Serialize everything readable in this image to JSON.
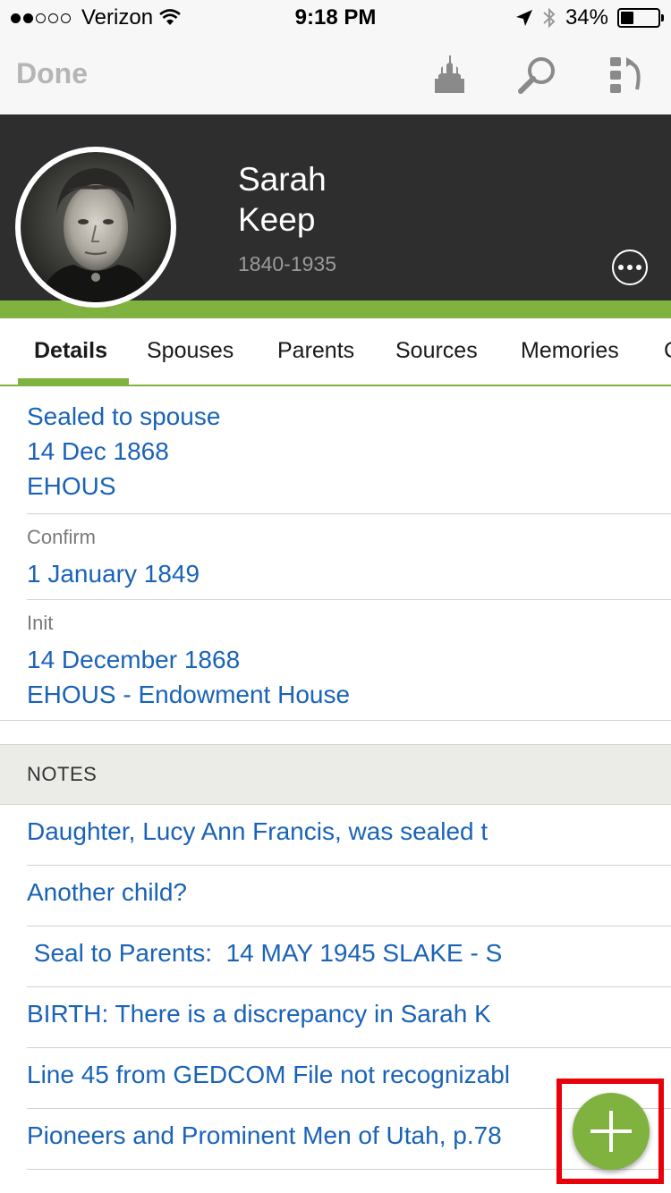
{
  "status_bar": {
    "carrier": "Verizon",
    "time": "9:18 PM",
    "battery_percent": "34%",
    "battery_level": 0.34,
    "signal_bars_filled": 2,
    "signal_bars_total": 5
  },
  "toolbar": {
    "done_label": "Done",
    "icons": [
      "temple-icon",
      "search-icon",
      "tree-switch-icon"
    ]
  },
  "person": {
    "first_name": "Sarah",
    "last_name": "Keep",
    "dates": "1840-1935"
  },
  "tabs": [
    {
      "label": "Details",
      "active": true
    },
    {
      "label": "Spouses"
    },
    {
      "label": "Parents"
    },
    {
      "label": "Sources"
    },
    {
      "label": "Memories"
    },
    {
      "label": "C"
    }
  ],
  "details": {
    "sealed": {
      "title": "Sealed to spouse",
      "date": "14 Dec 1868",
      "temple": "EHOUS"
    },
    "confirm": {
      "label": "Confirm",
      "date": "1 January 1849"
    },
    "init": {
      "label": "Init",
      "date": "14 December 1868",
      "temple": "EHOUS - Endowment House"
    }
  },
  "notes": {
    "header": "NOTES",
    "items": [
      "Daughter, Lucy Ann Francis, was sealed t",
      "Another child?",
      " Seal to Parents:  14 MAY 1945 SLAKE - S",
      "BIRTH: There is a discrepancy in Sarah K",
      "Line 45 from GEDCOM File not recognizabl",
      "Pioneers and Prominent Men of Utah, p.78"
    ]
  },
  "colors": {
    "accent_green": "#7fb23f",
    "link_blue": "#1a63b7",
    "header_dark": "#2e2e2e",
    "highlight_red": "#e8000b"
  }
}
